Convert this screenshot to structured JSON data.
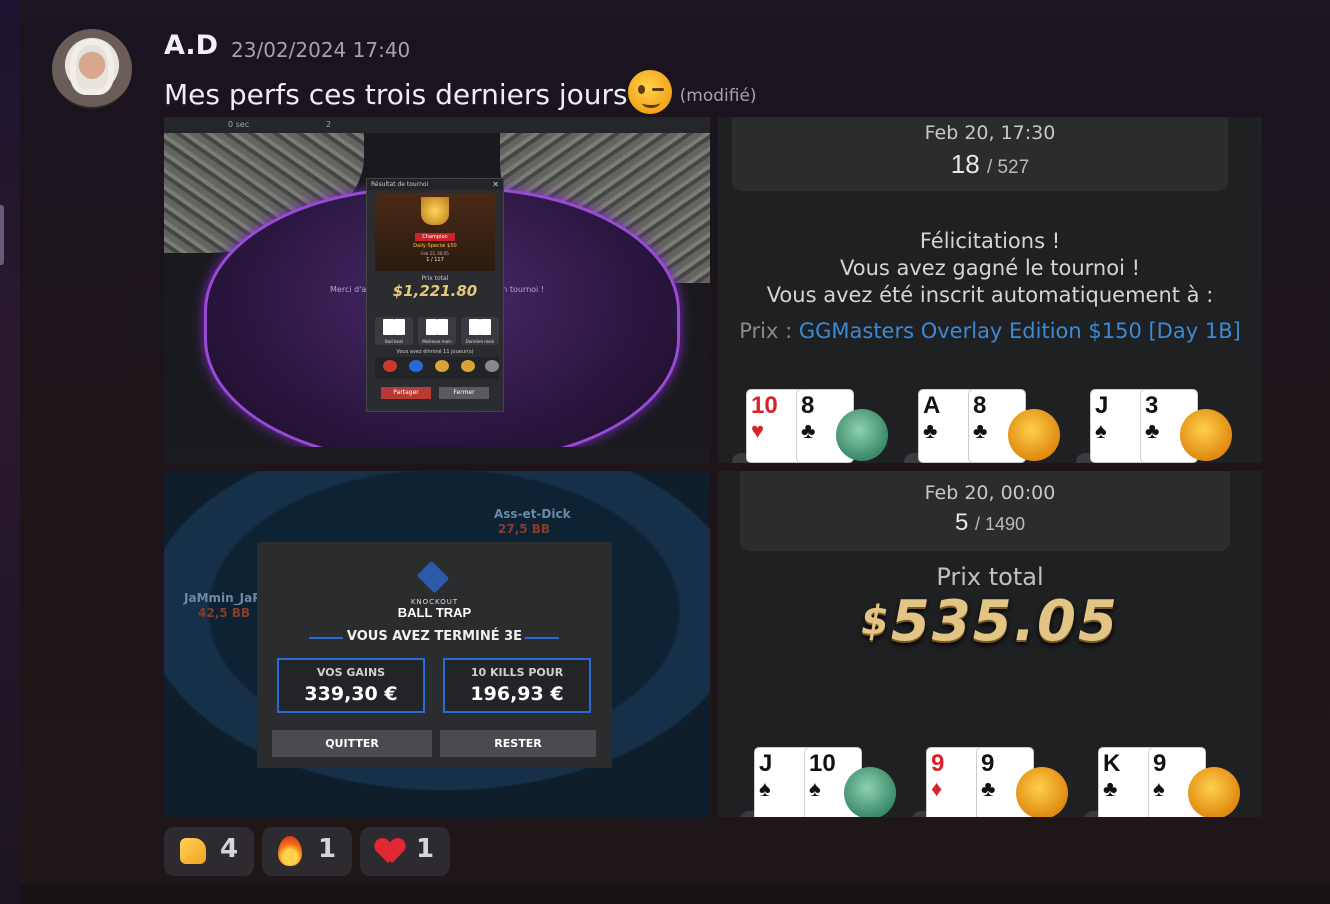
{
  "message": {
    "author": "A.D",
    "timestamp": "23/02/2024 17:40",
    "text": "Mes perfs ces trois derniers jours",
    "emoji": "wink-emoji",
    "edited_label": "(modifié)"
  },
  "image1": {
    "topbar_time": "0 sec",
    "topbar_count": "2",
    "modal_title": "Résultat de tournoi",
    "champion_label": "Champion",
    "tournament_name": "Daily Special $50",
    "tournament_date": "Feb 23, 00:05",
    "rank": "1 / 117",
    "prize_label": "Prix total",
    "prize": "$1,221.80",
    "hand_labels": [
      "Bad beat",
      "Meilleure main",
      "Dernière main"
    ],
    "eliminated_text": "Vous avez éliminé 11 joueur(s)",
    "share_button": "Partager",
    "close_button": "Fermer",
    "felt_left": "Merci d'av",
    "felt_right": "in tournoi !"
  },
  "image2": {
    "date": "Feb 20, 17:30",
    "rank": "18",
    "total": "/ 527",
    "congrats_1": "Félicitations !",
    "congrats_2": "Vous avez gagné le tournoi !",
    "congrats_3": "Vous avez été inscrit automatiquement à :",
    "prize_prefix": "Prix :",
    "prize_event": "GGMasters Overlay Edition $150 [Day 1B]",
    "hands": [
      {
        "c1": "10",
        "s1": "♥",
        "c2": "8",
        "s2": "♣"
      },
      {
        "c1": "A",
        "s1": "♣",
        "c2": "8",
        "s2": "♣"
      },
      {
        "c1": "J",
        "s1": "♠",
        "c2": "3",
        "s2": "♣"
      }
    ]
  },
  "image3": {
    "seat_left_name": "JaMmin_JaRs",
    "seat_left_bb": "42,5 BB",
    "seat_top_name": "Ass-et-Dick",
    "seat_top_bb": "27,5 BB",
    "logo_line1": "KNOCKOUT",
    "logo_line2": "BALL TRAP",
    "finish_text": "VOUS AVEZ TERMINÉ 3E",
    "gains_label": "VOS GAINS",
    "gains_value": "339,30 €",
    "kills_label": "10 KILLS POUR",
    "kills_value": "196,93 €",
    "quit_button": "QUITTER",
    "stay_button": "RESTER"
  },
  "image4": {
    "date": "Feb 20, 00:00",
    "rank": "5",
    "total": "/ 1490",
    "prize_label": "Prix total",
    "prize_currency": "$",
    "prize_value": "535.05",
    "hands": [
      {
        "c1": "J",
        "s1": "♠",
        "c2": "10",
        "s2": "♠"
      },
      {
        "c1": "9",
        "s1": "♦",
        "c2": "9",
        "s2": "♣"
      },
      {
        "c1": "K",
        "s1": "♣",
        "c2": "9",
        "s2": "♠"
      }
    ]
  },
  "reactions": [
    {
      "icon": "thumbs-up-icon",
      "count": "4"
    },
    {
      "icon": "fire-icon",
      "count": "1"
    },
    {
      "icon": "heart-icon",
      "count": "1"
    }
  ]
}
